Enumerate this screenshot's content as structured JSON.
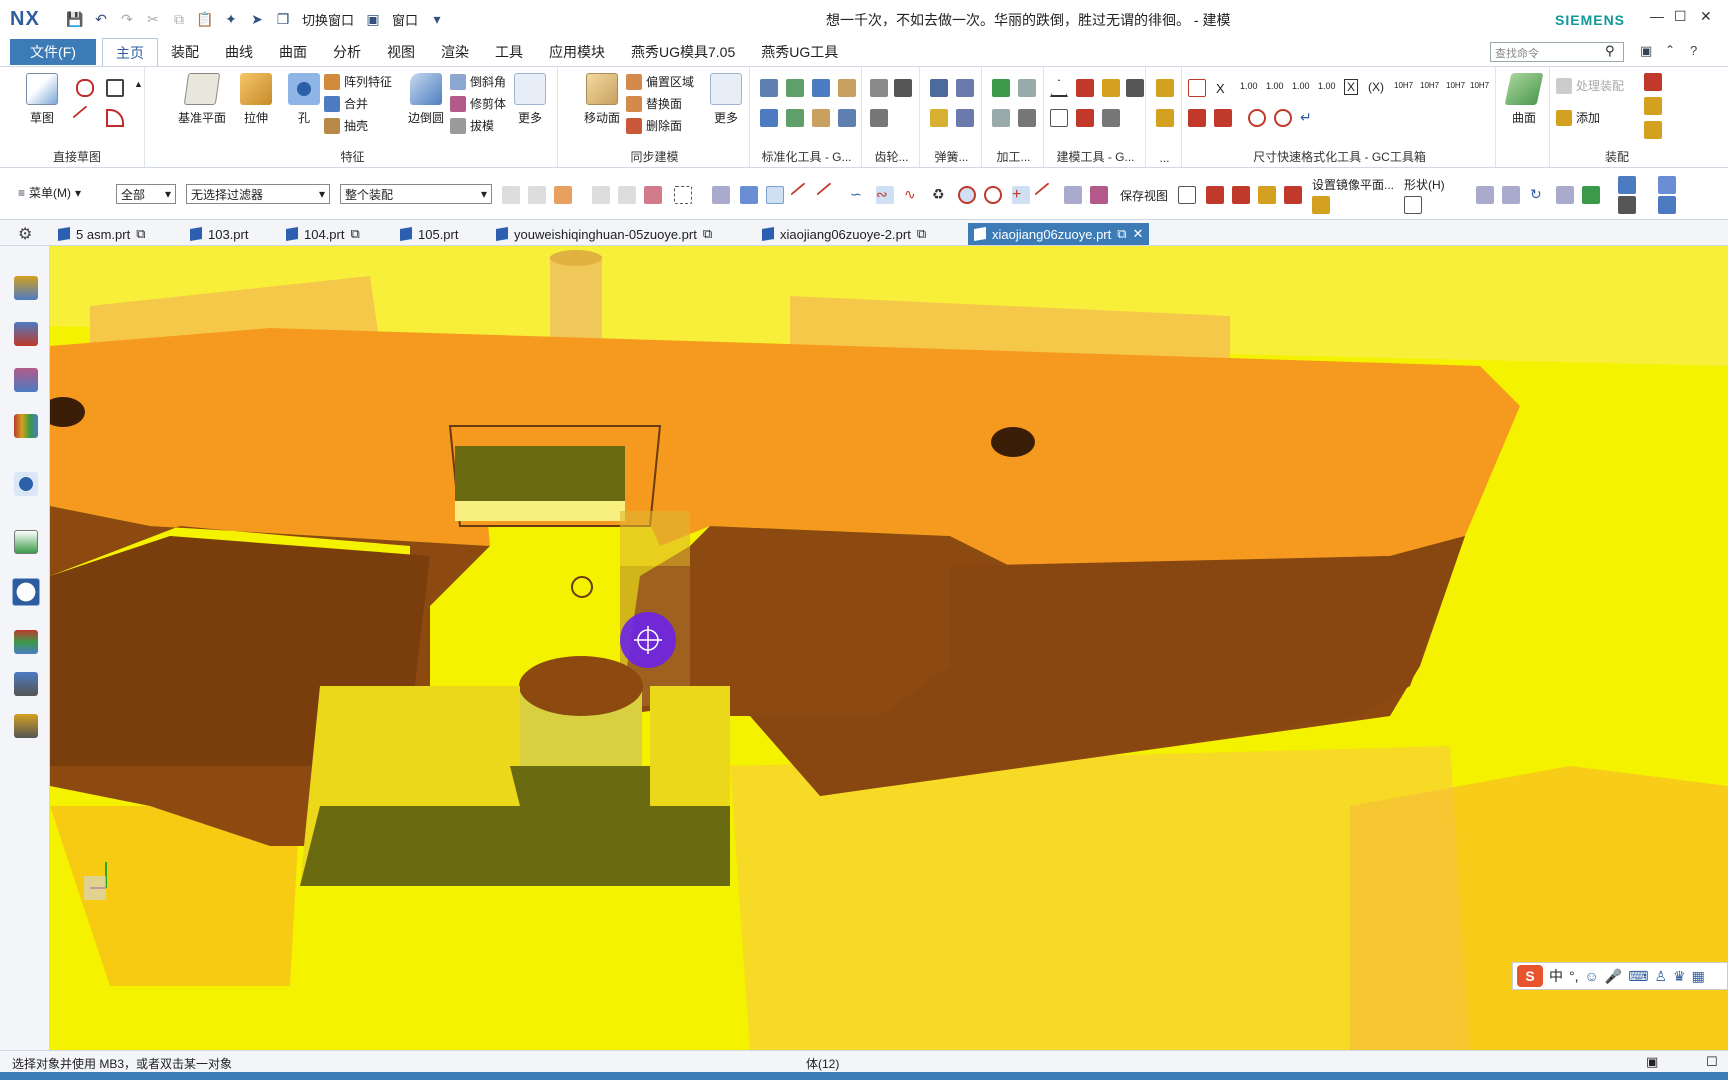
{
  "app": {
    "logo": "NX",
    "title": "想一千次，不如去做一次。华丽的跌倒，胜过无谓的徘徊。 - 建模",
    "brand": "SIEMENS",
    "switch_window": "切换窗口",
    "window_menu": "窗口"
  },
  "ribbon_tabs": {
    "file": "文件(F)",
    "items": [
      "主页",
      "装配",
      "曲线",
      "曲面",
      "分析",
      "视图",
      "渲染",
      "工具",
      "应用模块",
      "燕秀UG模具7.05",
      "燕秀UG工具"
    ]
  },
  "search": {
    "placeholder": "查找命令"
  },
  "ribbon": {
    "sketch": {
      "label": "草图",
      "group": "直接草图"
    },
    "feature": {
      "datum": "基准平面",
      "extrude": "拉伸",
      "hole": "孔",
      "pattern": "阵列特征",
      "unite": "合并",
      "shell": "抽壳",
      "edge_blend": "边倒圆",
      "chamfer": "倒斜角",
      "trim_body": "修剪体",
      "draft": "拔模",
      "more": "更多",
      "group": "特征"
    },
    "sync": {
      "move_face": "移动面",
      "offset_region": "偏置区域",
      "replace_face": "替换面",
      "delete_face": "删除面",
      "more": "更多",
      "group": "同步建模"
    },
    "groups": {
      "standard": "标准化工具 - G...",
      "gear": "齿轮...",
      "spring": "弹簧...",
      "machining": "加工...",
      "modeling_tools": "建模工具 - G...",
      "dots": "...",
      "dimension": "尺寸快速格式化工具 - GC工具箱",
      "assembly": "装配"
    },
    "dim_labels": [
      "X",
      "1.00",
      "1.00",
      "1.00",
      "1.00",
      "X",
      "(X)",
      "10H7",
      "10H7",
      "10H7",
      "10H7"
    ],
    "surface": "曲面",
    "asm_process": "处理装配",
    "asm_add": "添加"
  },
  "toolbar": {
    "menu": "菜单(M)",
    "filter_all": "全部",
    "filter_type": "无选择过滤器",
    "scope": "整个装配",
    "save_view": "保存视图",
    "mirror_plane": "设置镜像平面...",
    "shape": "形状(H)"
  },
  "doc_tabs": [
    {
      "label": "5 asm.prt",
      "active": false
    },
    {
      "label": "103.prt",
      "active": false
    },
    {
      "label": "104.prt",
      "active": false
    },
    {
      "label": "105.prt",
      "active": false
    },
    {
      "label": "youweishiqinghuan-05zuoye.prt",
      "active": false
    },
    {
      "label": "xiaojiang06zuoye-2.prt",
      "active": false
    },
    {
      "label": "xiaojiang06zuoye.prt",
      "active": true
    }
  ],
  "ime": {
    "logo": "S",
    "lang": "中"
  },
  "status": {
    "prompt": "选择对象并使用 MB3，或者双击某一对象",
    "selection": "体(12)"
  },
  "colors": {
    "accent": "#3c7bb6",
    "viewport_bg": "#f5f200",
    "part_top": "#f59a1f",
    "part_side": "#8c4a10",
    "cursor": "#6a23e8"
  }
}
